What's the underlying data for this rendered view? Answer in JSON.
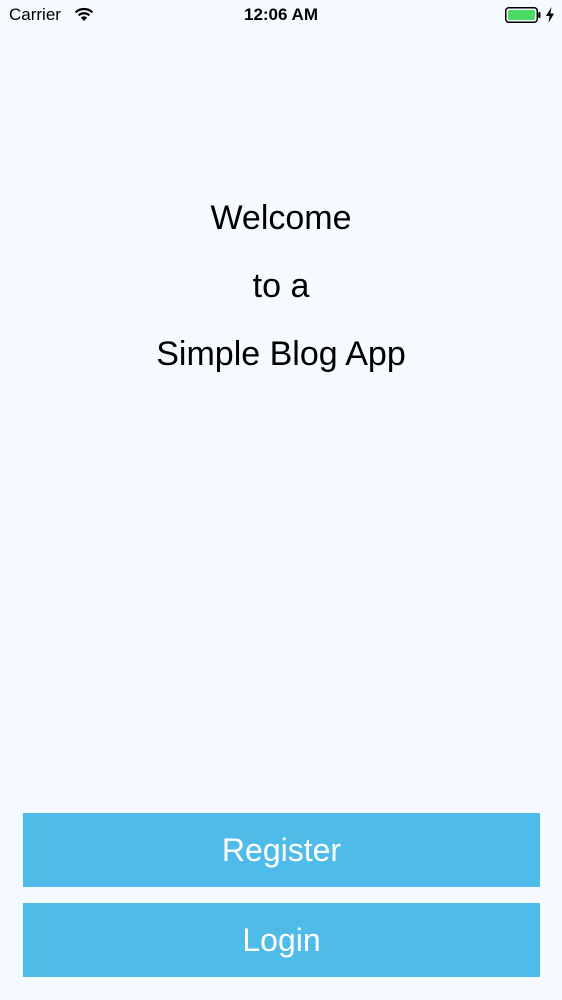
{
  "status_bar": {
    "carrier": "Carrier",
    "time": "12:06 AM",
    "battery_color": "#4cd964",
    "wifi_icon": "wifi-icon",
    "battery_icon": "battery-icon",
    "charging_icon": "charging-bolt-icon"
  },
  "welcome": {
    "line1": "Welcome",
    "line2": "to a",
    "line3": "Simple Blog App"
  },
  "actions": {
    "register_label": "Register",
    "login_label": "Login",
    "button_color": "#4ebbe9"
  }
}
